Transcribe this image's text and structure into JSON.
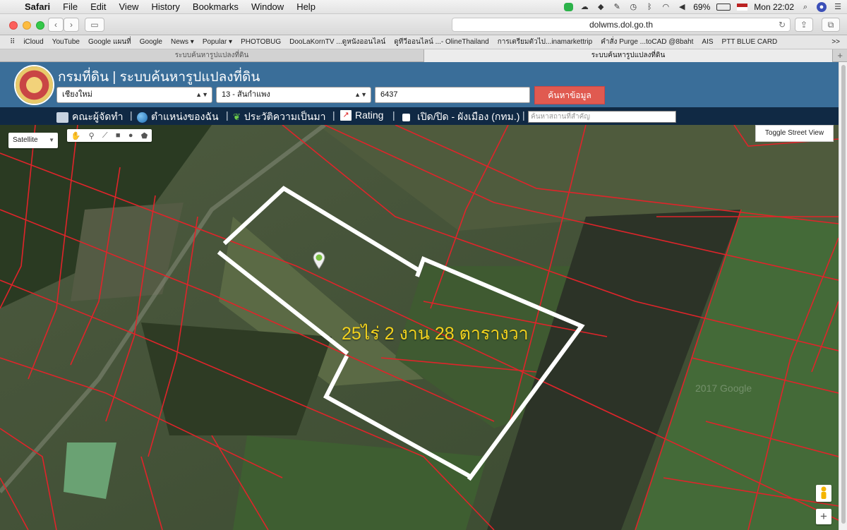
{
  "menubar": {
    "apple_glyph": "",
    "app_name": "Safari",
    "items": [
      "File",
      "Edit",
      "View",
      "History",
      "Bookmarks",
      "Window",
      "Help"
    ],
    "battery": "69%",
    "clock": "Mon 22:02",
    "status_icons": [
      "line-icon",
      "cloud-icon",
      "dropbox-icon",
      "evernote-icon",
      "time-machine-icon",
      "bluetooth-icon",
      "wifi-icon",
      "volume-icon",
      "battery-icon",
      "flag-icon",
      "spotlight-icon",
      "siri-icon",
      "notification-center-icon"
    ]
  },
  "browser": {
    "url": "dolwms.dol.go.th",
    "bookmarks": [
      "iCloud",
      "YouTube",
      "Google แผนที่",
      "Google",
      "News ▾",
      "Popular ▾",
      "PHOTOBUG",
      "DooLaKornTV ...ดูหนังออนไลน์",
      "ดูทีวีออนไลน์ ...- OlineThailand",
      "การเตรียมตัวไป...inamarkettrip",
      "คำสั่ง Purge ...toCAD @8baht",
      "AIS",
      "PTT BLUE CARD"
    ],
    "more_bookmarks": ">>",
    "tabs": [
      {
        "title": "ระบบค้นหารูปแปลงที่ดิน",
        "active": false
      },
      {
        "title": "ระบบค้นหารูปแปลงที่ดิน",
        "active": true
      }
    ],
    "new_tab": "+"
  },
  "site": {
    "title": "กรมที่ดิน | ระบบค้นหารูปแปลงที่ดิน",
    "province": "เชียงใหม่",
    "district": "13 - สันกำแพง",
    "parcel_number": "6437",
    "search_button": "ค้นหาข้อมูล",
    "nav": {
      "team": "คณะผู้จัดทำ",
      "my_location": "ตำแหน่งของฉัน",
      "history": "ประวัติความเป็นมา",
      "rating": "Rating",
      "toggle_cityplan": "เปิด/ปิด - ผังเมือง (กทม.)",
      "place_search_placeholder": "ค้นหาสถานที่สำคัญ",
      "separator": "|"
    }
  },
  "map": {
    "map_type": "Satellite",
    "toggle_street_view": "Toggle Street View",
    "zoom_in": "+",
    "area_label": "25ไร่ 2 งาน 28 ตารางวา",
    "watermark": "2017 Google"
  },
  "colors": {
    "header_bg": "#3a6e99",
    "navbar_bg": "#102944",
    "search_button": "#e05a50",
    "parcel_lines": "#e0242a",
    "area_label": "#f2d21e",
    "highlight_outline": "#ffffff"
  }
}
